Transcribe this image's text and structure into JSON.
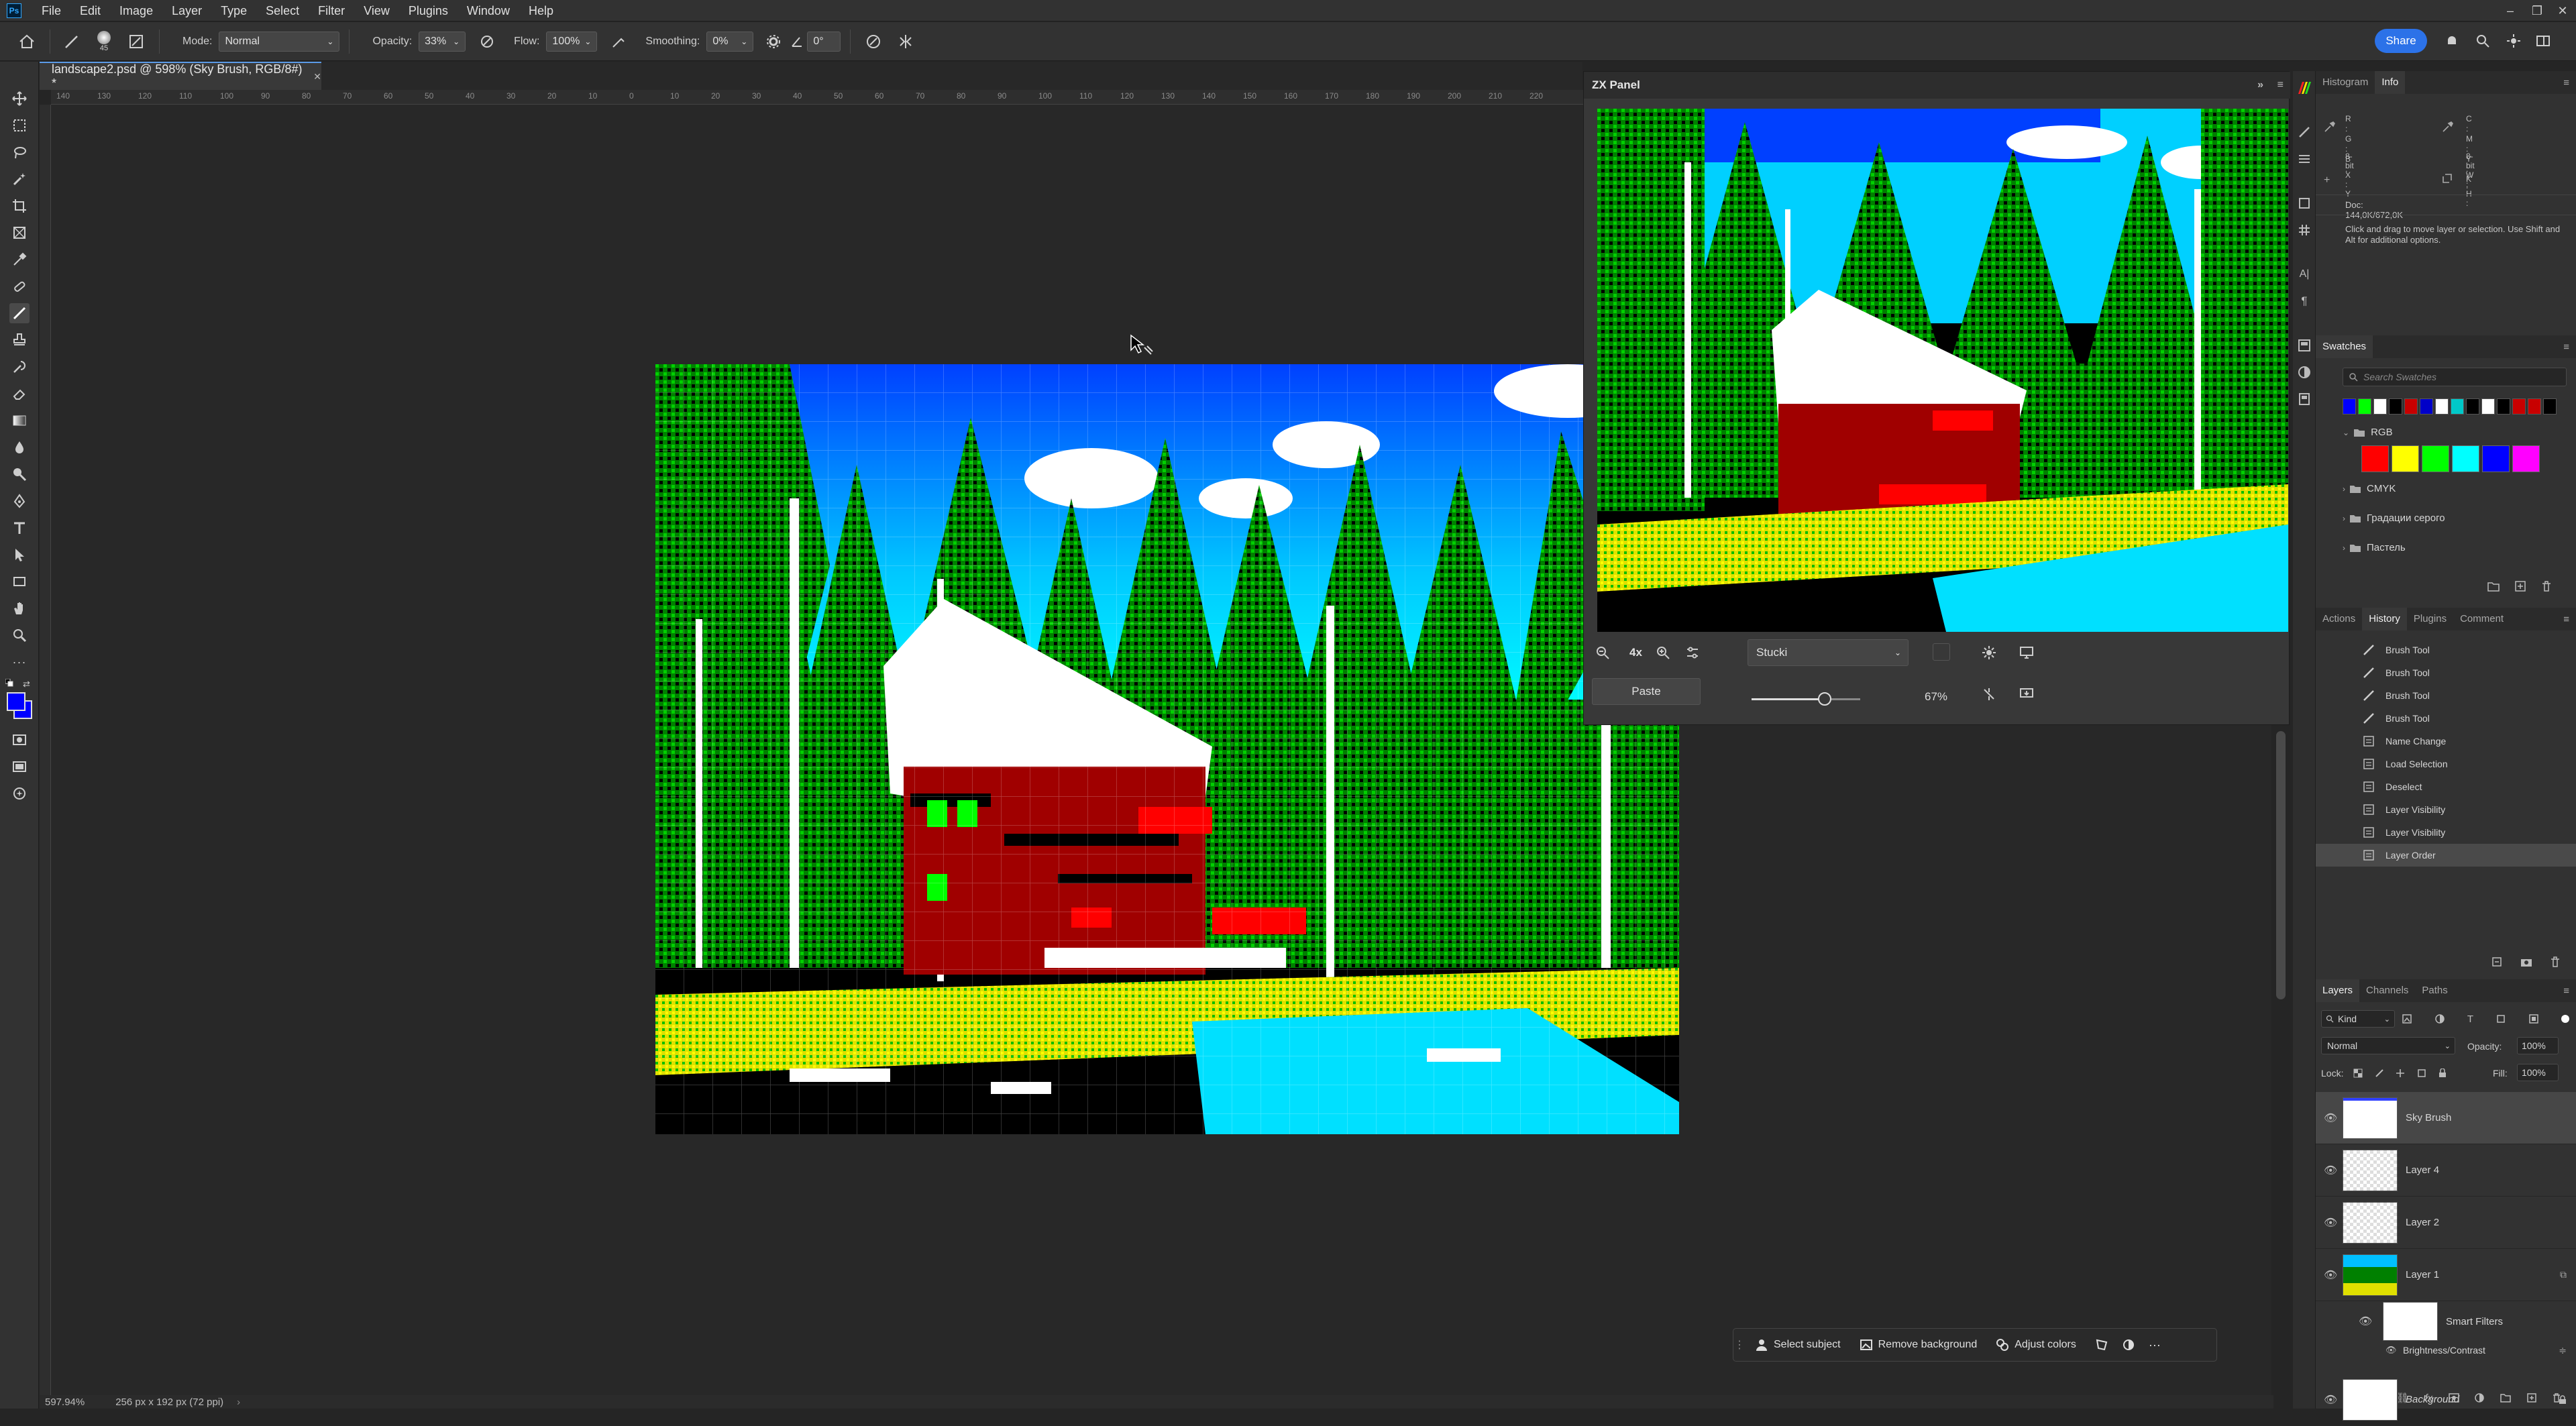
{
  "app": {
    "logo": "Ps",
    "menu": [
      "File",
      "Edit",
      "Image",
      "Layer",
      "Type",
      "Select",
      "Filter",
      "View",
      "Plugins",
      "Window",
      "Help"
    ]
  },
  "options_bar": {
    "brush_size": "45",
    "mode_label": "Mode:",
    "mode_value": "Normal",
    "opacity_label": "Opacity:",
    "opacity_value": "33%",
    "flow_label": "Flow:",
    "flow_value": "100%",
    "smoothing_label": "Smoothing:",
    "smoothing_value": "0%",
    "angle_value": "0°",
    "share_label": "Share"
  },
  "document": {
    "tab_title": "landscape2.psd @ 598% (Sky Brush, RGB/8#) *",
    "ruler_ticks": [
      "140",
      "130",
      "120",
      "110",
      "100",
      "90",
      "80",
      "70",
      "60",
      "50",
      "40",
      "30",
      "20",
      "10",
      "0",
      "10",
      "20",
      "30",
      "40",
      "50",
      "60",
      "70",
      "80",
      "90",
      "100",
      "110",
      "120",
      "130",
      "140",
      "150",
      "160",
      "170",
      "180",
      "190",
      "200",
      "210",
      "220"
    ],
    "zoom_status": "597.94%",
    "size_status": "256 px x 192 px (72 ppi)"
  },
  "zx_panel": {
    "title": "ZX Panel",
    "zoom_level": "4x",
    "dither_method": "Stucki",
    "paste_label": "Paste",
    "strength_value": "67%",
    "strength_fraction": 0.67
  },
  "info_panel": {
    "tabs": [
      "Histogram",
      "Info"
    ],
    "active_tab": "Info",
    "rgb1": [
      "R :",
      "G :",
      "B :"
    ],
    "rgb2": [
      "C :",
      "M :",
      "Y :",
      "K :"
    ],
    "bit1": "8-bit",
    "bit2": "8-bit",
    "xy": [
      "X :",
      "Y :"
    ],
    "wh": [
      "W :",
      "H :"
    ],
    "doc": "Doc: 144,0K/672,0K",
    "hint": "Click and drag to move layer or selection.  Use Shift and Alt for additional options."
  },
  "swatches_panel": {
    "title": "Swatches",
    "search_placeholder": "Search Swatches",
    "recent_colors": [
      "#0000ff",
      "#00ff00",
      "#ffffff",
      "#000000",
      "#c80000",
      "#0000c8",
      "#ffffff",
      "#00c8c8",
      "#000000",
      "#ffffff",
      "#000000",
      "#c80000",
      "#c80000",
      "#000000"
    ],
    "groups": [
      {
        "name": "RGB",
        "colors": [
          "#ff0000",
          "#ffff00",
          "#00ff00",
          "#00ffff",
          "#0000ff",
          "#ff00ff"
        ]
      },
      {
        "name": "CMYK"
      },
      {
        "name": "Градации серого"
      },
      {
        "name": "Пастель"
      }
    ]
  },
  "history_panel": {
    "tabs": [
      "Actions",
      "History",
      "Plugins",
      "Comment"
    ],
    "active_tab": "History",
    "items": [
      "Brush Tool",
      "Brush Tool",
      "Brush Tool",
      "Brush Tool",
      "Name Change",
      "Load Selection",
      "Deselect",
      "Layer Visibility",
      "Layer Visibility",
      "Layer Order"
    ]
  },
  "layers_panel": {
    "tabs": [
      "Layers",
      "Channels",
      "Paths"
    ],
    "active_tab": "Layers",
    "kind_label": "Kind",
    "blend_mode": "Normal",
    "opacity_label": "Opacity:",
    "opacity_value": "100%",
    "lock_label": "Lock:",
    "fill_label": "Fill:",
    "fill_value": "100%",
    "layers": [
      "Sky Brush",
      "Layer 4",
      "Layer 2",
      "Layer 1"
    ],
    "smart_filters": "Smart Filters",
    "filter_name": "Brightness/Contrast",
    "background": "Background"
  },
  "context_bar": {
    "select_subject": "Select subject",
    "remove_background": "Remove background",
    "adjust_colors": "Adjust colors"
  }
}
